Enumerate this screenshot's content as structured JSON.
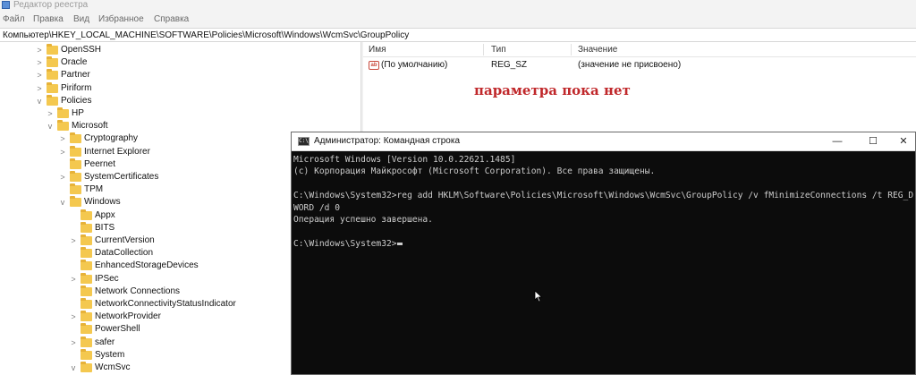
{
  "window": {
    "title": "Редактор реестра"
  },
  "menu": [
    "Файл",
    "Правка",
    "Вид",
    "Избранное",
    "Справка"
  ],
  "address": "Компьютер\\HKEY_LOCAL_MACHINE\\SOFTWARE\\Policies\\Microsoft\\Windows\\WcmSvc\\GroupPolicy",
  "tree": [
    {
      "label": "OpenSSH",
      "chevron": ">"
    },
    {
      "label": "Oracle",
      "chevron": ">"
    },
    {
      "label": "Partner",
      "chevron": ">"
    },
    {
      "label": "Piriform",
      "chevron": ">"
    },
    {
      "label": "Policies",
      "chevron": "v"
    },
    {
      "label": "HP",
      "chevron": ">"
    },
    {
      "label": "Microsoft",
      "chevron": "v"
    },
    {
      "label": "Cryptography",
      "chevron": ">"
    },
    {
      "label": "Internet Explorer",
      "chevron": ">"
    },
    {
      "label": "Peernet",
      "chevron": ""
    },
    {
      "label": "SystemCertificates",
      "chevron": ">"
    },
    {
      "label": "TPM",
      "chevron": ""
    },
    {
      "label": "Windows",
      "chevron": "v"
    },
    {
      "label": "Appx",
      "chevron": ""
    },
    {
      "label": "BITS",
      "chevron": ""
    },
    {
      "label": "CurrentVersion",
      "chevron": ">"
    },
    {
      "label": "DataCollection",
      "chevron": ""
    },
    {
      "label": "EnhancedStorageDevices",
      "chevron": ""
    },
    {
      "label": "IPSec",
      "chevron": ">"
    },
    {
      "label": "Network Connections",
      "chevron": ""
    },
    {
      "label": "NetworkConnectivityStatusIndicator",
      "chevron": ""
    },
    {
      "label": "NetworkProvider",
      "chevron": ">"
    },
    {
      "label": "PowerShell",
      "chevron": ""
    },
    {
      "label": "safer",
      "chevron": ">"
    },
    {
      "label": "System",
      "chevron": ""
    },
    {
      "label": "WcmSvc",
      "chevron": "v"
    }
  ],
  "values_header": {
    "name": "Имя",
    "type": "Тип",
    "value": "Значение"
  },
  "values_rows": [
    {
      "name": "(По умолчанию)",
      "type": "REG_SZ",
      "value": "(значение не присвоено)",
      "icon": "ab-string-icon"
    }
  ],
  "annotation": "параметра пока нет",
  "cmd": {
    "title": "Администратор: Командная строка",
    "buttons": {
      "minimize": "—",
      "maximize": "☐",
      "close": "✕"
    },
    "lines": [
      "Microsoft Windows [Version 10.0.22621.1485]",
      "(c) Корпорация Майкрософт (Microsoft Corporation). Все права защищены.",
      "",
      "C:\\Windows\\System32>reg add HKLM\\Software\\Policies\\Microsoft\\Windows\\WcmSvc\\GroupPolicy /v fMinimizeConnections /t REG_D",
      "WORD /d 0",
      "Операция успешно завершена.",
      "",
      "C:\\Windows\\System32>"
    ]
  }
}
